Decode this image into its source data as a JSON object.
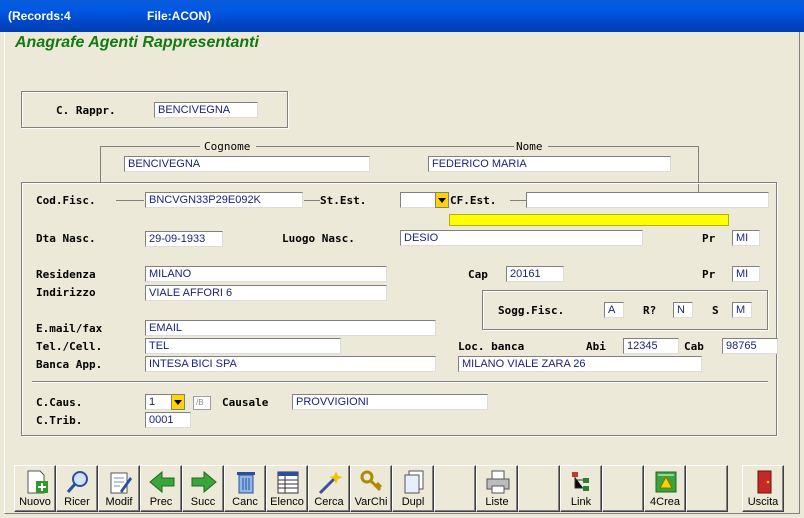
{
  "titlebar": {
    "records": "(Records:4",
    "file": "File:ACON)"
  },
  "form": {
    "title": "Anagrafe Agenti Rappresentanti"
  },
  "rappr": {
    "label": "C. Rappr.",
    "value": "BENCIVEGNA"
  },
  "cognome": {
    "label": "Cognome",
    "value": "BENCIVEGNA"
  },
  "nome": {
    "label": "Nome",
    "value": "FEDERICO MARIA"
  },
  "codfisc": {
    "label": "Cod.Fisc.",
    "value": "BNCVGN33P29E092K"
  },
  "stest": {
    "label": "St.Est.",
    "value": ""
  },
  "cfest": {
    "label": "CF.Est.",
    "value": ""
  },
  "dtanasc": {
    "label": "Dta Nasc.",
    "value": "29-09-1933"
  },
  "luogonasc": {
    "label": "Luogo Nasc.",
    "value": "DESIO"
  },
  "pr_nasc": {
    "label": "Pr",
    "value": "MI"
  },
  "residenza": {
    "label": "Residenza",
    "value": "MILANO"
  },
  "cap": {
    "label": "Cap",
    "value": "20161"
  },
  "pr_res": {
    "label": "Pr",
    "value": "MI"
  },
  "indirizzo": {
    "label": "Indirizzo",
    "value": "VIALE AFFORI 6"
  },
  "sogg": {
    "label": "Sogg.Fisc.",
    "value": "A",
    "r_label": "R?",
    "r_value": "N",
    "s_label": "S",
    "s_value": "M"
  },
  "email": {
    "label": "E.mail/fax",
    "value": "EMAIL"
  },
  "tel": {
    "label": "Tel./Cell.",
    "value": "TEL"
  },
  "locbanca": {
    "label": "Loc. banca"
  },
  "abi": {
    "label": "Abi",
    "value": "12345"
  },
  "cab": {
    "label": "Cab",
    "value": "98765"
  },
  "banca": {
    "label": "Banca App.",
    "value": "INTESA BICI SPA",
    "loc_value": "MILANO VIALE ZARA 26"
  },
  "ccaus": {
    "label": "C.Caus.",
    "value": "1",
    "small": "/B"
  },
  "causale": {
    "label": "Causale",
    "value": "PROVVIGIONI"
  },
  "ctrib": {
    "label": "C.Trib.",
    "value": "0001"
  },
  "toolbar": {
    "buttons": [
      {
        "label": "Nuovo",
        "icon": "new-doc-icon"
      },
      {
        "label": "Ricer",
        "icon": "search-icon"
      },
      {
        "label": "Modif",
        "icon": "edit-icon"
      },
      {
        "label": "Prec",
        "icon": "arrow-left-icon"
      },
      {
        "label": "Succ",
        "icon": "arrow-right-icon"
      },
      {
        "label": "Canc",
        "icon": "trash-icon"
      },
      {
        "label": "Elenco",
        "icon": "list-icon"
      },
      {
        "label": "Cerca",
        "icon": "magic-wand-icon"
      },
      {
        "label": "VarChi",
        "icon": "keys-icon"
      },
      {
        "label": "Dupl",
        "icon": "duplicate-icon"
      },
      {
        "label": "",
        "icon": ""
      },
      {
        "label": "Liste",
        "icon": "printer-icon"
      },
      {
        "label": "",
        "icon": ""
      },
      {
        "label": "Link",
        "icon": "tree-icon"
      },
      {
        "label": "",
        "icon": ""
      },
      {
        "label": "4Crea",
        "icon": "create-icon"
      },
      {
        "label": "",
        "icon": ""
      },
      {
        "label": "Uscita",
        "icon": "exit-door-icon"
      }
    ]
  }
}
